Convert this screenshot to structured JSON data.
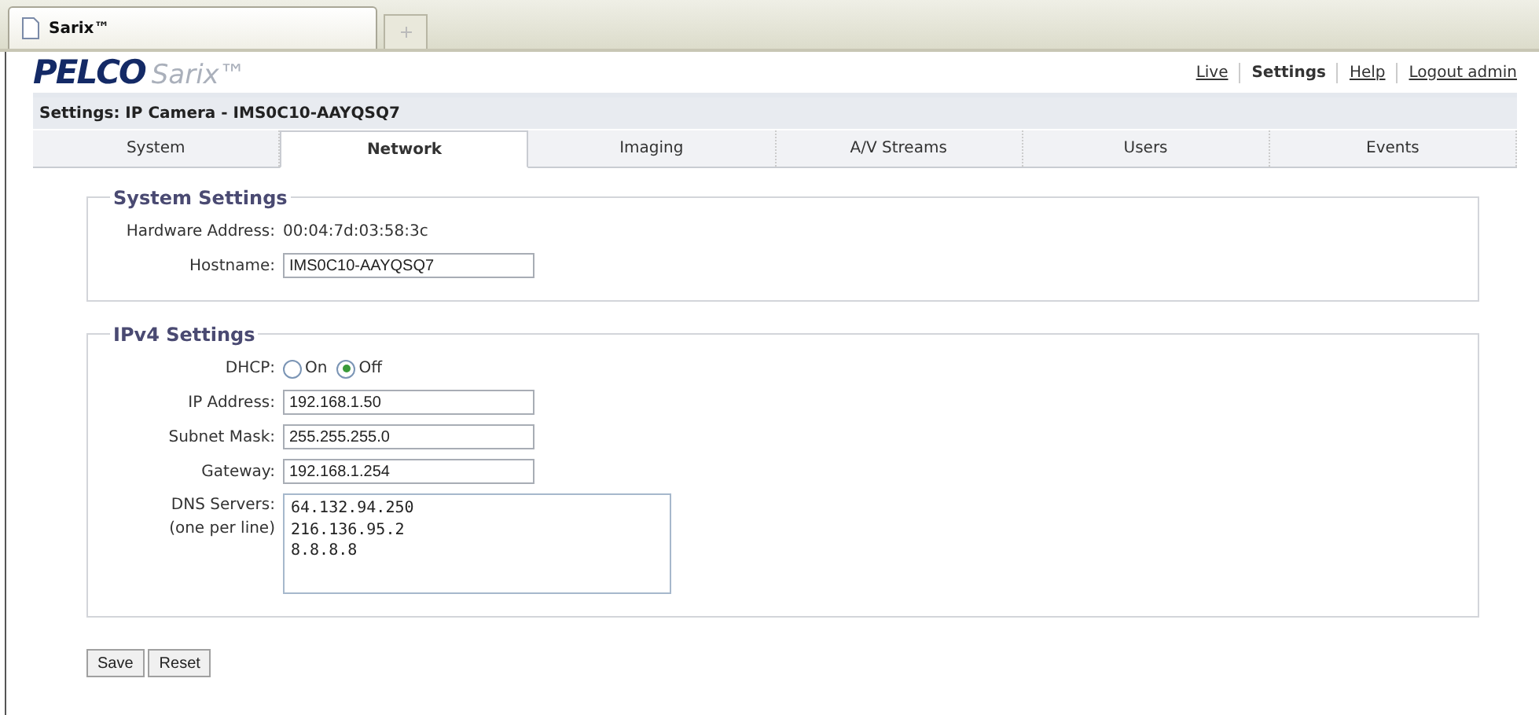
{
  "browser_tab": {
    "title": "Sarix™"
  },
  "header": {
    "logo_brand": "PELCO",
    "logo_product": "Sarix™",
    "nav": [
      {
        "label": "Live",
        "selected": false
      },
      {
        "label": "Settings",
        "selected": true
      },
      {
        "label": "Help",
        "selected": false
      },
      {
        "label": "Logout admin",
        "selected": false
      }
    ]
  },
  "page_title": "Settings: IP Camera - IMS0C10-AAYQSQ7",
  "tabs": [
    {
      "label": "System",
      "selected": false
    },
    {
      "label": "Network",
      "selected": true
    },
    {
      "label": "Imaging",
      "selected": false
    },
    {
      "label": "A/V Streams",
      "selected": false
    },
    {
      "label": "Users",
      "selected": false
    },
    {
      "label": "Events",
      "selected": false
    }
  ],
  "system_settings": {
    "title": "System Settings",
    "hardware_address": {
      "label": "Hardware Address:",
      "value": "00:04:7d:03:58:3c"
    },
    "hostname": {
      "label": "Hostname:",
      "value": "IMS0C10-AAYQSQ7"
    }
  },
  "ipv4_settings": {
    "title": "IPv4 Settings",
    "dhcp": {
      "label": "DHCP:",
      "options": [
        {
          "label": "On",
          "selected": false
        },
        {
          "label": "Off",
          "selected": true
        }
      ]
    },
    "fields": [
      {
        "label": "IP Address:",
        "value": "192.168.1.50"
      },
      {
        "label": "Subnet Mask:",
        "value": "255.255.255.0"
      },
      {
        "label": "Gateway:",
        "value": "192.168.1.254"
      }
    ],
    "dns_servers": {
      "label": "DNS Servers:",
      "hint": "(one per line)",
      "value": "64.132.94.250\n216.136.95.2\n8.8.8.8"
    }
  },
  "buttons": [
    "Save",
    "Reset"
  ]
}
